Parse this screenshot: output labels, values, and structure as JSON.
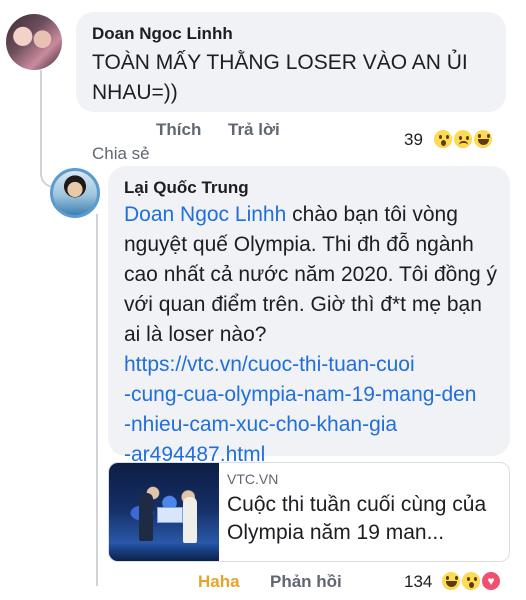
{
  "comment1": {
    "author": "Doan Ngoc Linhh",
    "text": "TOÀN MẤY THẰNG LOSER VÀO AN ỦI NHAU=))",
    "actions": {
      "like": "Thích",
      "reply": "Trả lời",
      "share": "Chia sẻ"
    },
    "reaction_count": "39",
    "reactions": [
      "wow-icon",
      "sad-icon",
      "haha-icon"
    ]
  },
  "reply1": {
    "author": "Lại Quốc Trung",
    "mention": "Doan Ngoc Linhh",
    "text": "chào bạn tôi vòng nguyệt quế Olympia. Thi đh đỗ ngành cao nhất cả nước năm 2020. Tôi đồng ý với quan điểm trên. Giờ thì đ*t mẹ bạn ai là loser nào?",
    "link_lines": [
      "https://vtc.vn/cuoc-thi-tuan-cuoi",
      "-cung-cua-olympia-nam-19-mang-den",
      "-nhieu-cam-xuc-cho-khan-gia",
      "-ar494487.html"
    ],
    "preview": {
      "source": "VTC.VN",
      "title": "Cuộc thi tuần cuối cùng của Olympia năm 19 man..."
    },
    "actions": {
      "haha": "Haha",
      "reply": "Phản hồi"
    },
    "reaction_count": "134",
    "reactions": [
      "haha-icon",
      "wow-icon",
      "love-icon"
    ]
  },
  "colors": {
    "bubble": "#f0f2f5",
    "link": "#216fdb",
    "haha_active": "#e8a32d",
    "meta": "#606770"
  }
}
